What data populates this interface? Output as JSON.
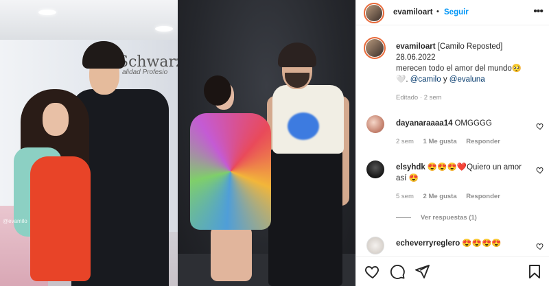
{
  "post": {
    "username": "evamiloart",
    "follow_label": "Seguir",
    "separator": "•",
    "more_label": "•••"
  },
  "caption": {
    "username": "evamiloart",
    "line1": "[Camilo Reposted]",
    "line2": "28.06.2022",
    "line3": "merecen todo el amor del mundo🥺",
    "line4_prefix": "🤍. ",
    "mention1": "@camilo",
    "connector": " y ",
    "mention2": "@evaluna",
    "edited": "Editado",
    "time": "2 sem"
  },
  "comments": [
    {
      "username": "dayanaraaaa14",
      "text": "OMGGGG",
      "time": "2 sem",
      "likes": "1 Me gusta",
      "reply": "Responder"
    },
    {
      "username": "elsyhdk",
      "text": "😍😍😍❤️Quiero un amor así 😍",
      "time": "5 sem",
      "likes": "2 Me gusta",
      "reply": "Responder",
      "view_replies": "Ver respuestas (1)"
    },
    {
      "username": "echeverryreglero",
      "text": "😍😍😍😍"
    }
  ],
  "photo": {
    "banner_brand": "Schwarz",
    "banner_sub": "alidad Profesio",
    "watermark": "@evamilo"
  },
  "colors": {
    "accent": "#0095f6",
    "mention": "#00376b",
    "meta": "#8e8e8e",
    "story_ring": "#e86a3a"
  },
  "icons": {
    "like": "heart-outline-icon",
    "comment": "comment-bubble-icon",
    "share": "paper-plane-icon",
    "save": "bookmark-icon",
    "more": "more-horizontal-icon"
  }
}
